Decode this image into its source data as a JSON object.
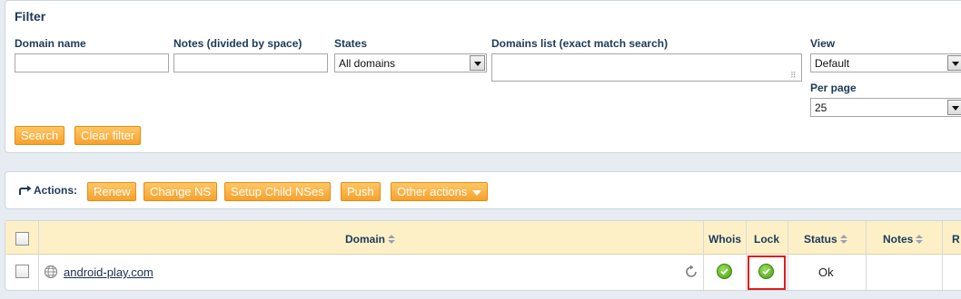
{
  "filter": {
    "title": "Filter",
    "domain_name_label": "Domain name",
    "domain_name_value": "",
    "notes_label": "Notes (divided by space)",
    "notes_value": "",
    "states_label": "States",
    "states_selected": "All domains",
    "domains_list_label": "Domains list (exact match search)",
    "domains_list_value": "",
    "view_label": "View",
    "view_selected": "Default",
    "per_page_label": "Per page",
    "per_page_selected": "25",
    "search_button": "Search",
    "clear_button": "Clear filter"
  },
  "actions": {
    "label": "Actions:",
    "renew": "Renew",
    "change_ns": "Change NS",
    "setup_child_nses": "Setup Child NSes",
    "push": "Push",
    "other_actions": "Other actions"
  },
  "table": {
    "columns": {
      "domain": "Domain",
      "whois": "Whois",
      "lock": "Lock",
      "status": "Status",
      "notes": "Notes",
      "r": "R"
    },
    "rows": [
      {
        "domain": "android-play.com",
        "whois": "ok",
        "lock": "ok",
        "status": "Ok",
        "notes": ""
      }
    ]
  },
  "colors": {
    "button_orange": "#f7a12b",
    "header_bg": "#fdf0c7",
    "highlight_red": "#e01b1b",
    "status_green": "#4a9e16"
  }
}
